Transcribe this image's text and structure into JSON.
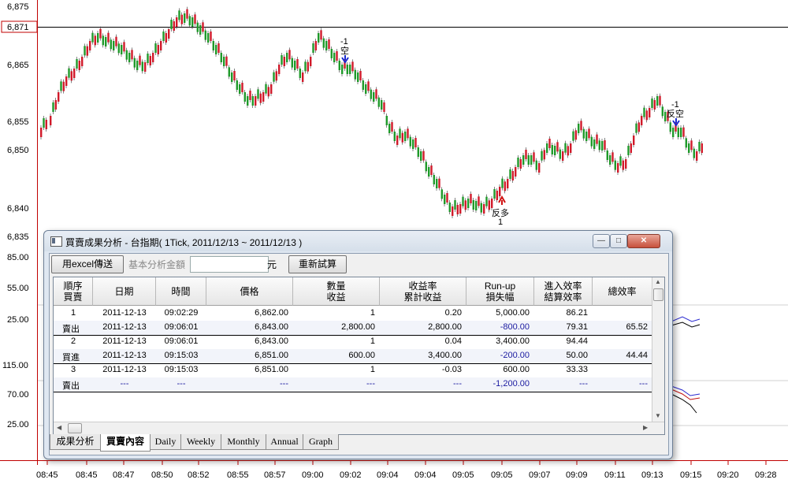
{
  "chart": {
    "price_labels": [
      "6,875",
      "6,871",
      "6,865",
      "6,855",
      "6,850",
      "6,840",
      "6,835"
    ],
    "indicator_labels": [
      "85.00",
      "55.00",
      "25.00",
      "115.00",
      "70.00",
      "25.00"
    ],
    "time_labels": [
      "08:45",
      "08:45",
      "08:47",
      "08:50",
      "08:52",
      "08:55",
      "08:57",
      "09:00",
      "09:02",
      "09:04",
      "09:04",
      "09:05",
      "09:05",
      "09:07",
      "09:09",
      "09:11",
      "09:13",
      "09:15",
      "09:20",
      "09:28"
    ],
    "signals": {
      "s1_qty": "-1",
      "s1_label": "空",
      "s2_label": "反多",
      "s2_qty": "1",
      "s3_qty": "-1",
      "s3_label": "反空"
    },
    "colors": {
      "up": "#d11a2a",
      "down": "#1f9a2a",
      "highlight": "#cc0000"
    }
  },
  "dialog": {
    "title": "買賣成果分析 - 台指期( 1Tick, 2011/12/13 ~ 2011/12/13 )",
    "toolbar": {
      "export_label": "用excel傳送",
      "amount_label": "基本分析金額",
      "amount_value": "",
      "unit": "元",
      "recalc_label": "重新試算"
    },
    "headers": [
      [
        "順序",
        "買賣"
      ],
      [
        "日期",
        ""
      ],
      [
        "時間",
        ""
      ],
      [
        "價格",
        ""
      ],
      [
        "數量",
        "收益"
      ],
      [
        "收益率",
        "累計收益"
      ],
      [
        "Run-up",
        "損失幅"
      ],
      [
        "進入效率",
        "結算效率"
      ],
      [
        "總效率",
        ""
      ]
    ],
    "rows": [
      [
        "1",
        "2011-12-13",
        "09:02:29",
        "6,862.00",
        "1",
        "0.20",
        "5,000.00",
        "86.21",
        ""
      ],
      [
        "賣出",
        "2011-12-13",
        "09:06:01",
        "6,843.00",
        "2,800.00",
        "2,800.00",
        "-800.00",
        "79.31",
        "65.52"
      ],
      [
        "2",
        "2011-12-13",
        "09:06:01",
        "6,843.00",
        "1",
        "0.04",
        "3,400.00",
        "94.44",
        ""
      ],
      [
        "買進",
        "2011-12-13",
        "09:15:03",
        "6,851.00",
        "600.00",
        "3,400.00",
        "-200.00",
        "50.00",
        "44.44"
      ],
      [
        "3",
        "2011-12-13",
        "09:15:03",
        "6,851.00",
        "1",
        "-0.03",
        "600.00",
        "33.33",
        ""
      ],
      [
        "賣出",
        "---",
        "---",
        "---",
        "---",
        "---",
        "-1,200.00",
        "---",
        "---"
      ]
    ],
    "tabs": [
      "成果分析",
      "買賣內容",
      "Daily",
      "Weekly",
      "Monthly",
      "Annual",
      "Graph"
    ],
    "active_tab": "買賣內容"
  }
}
